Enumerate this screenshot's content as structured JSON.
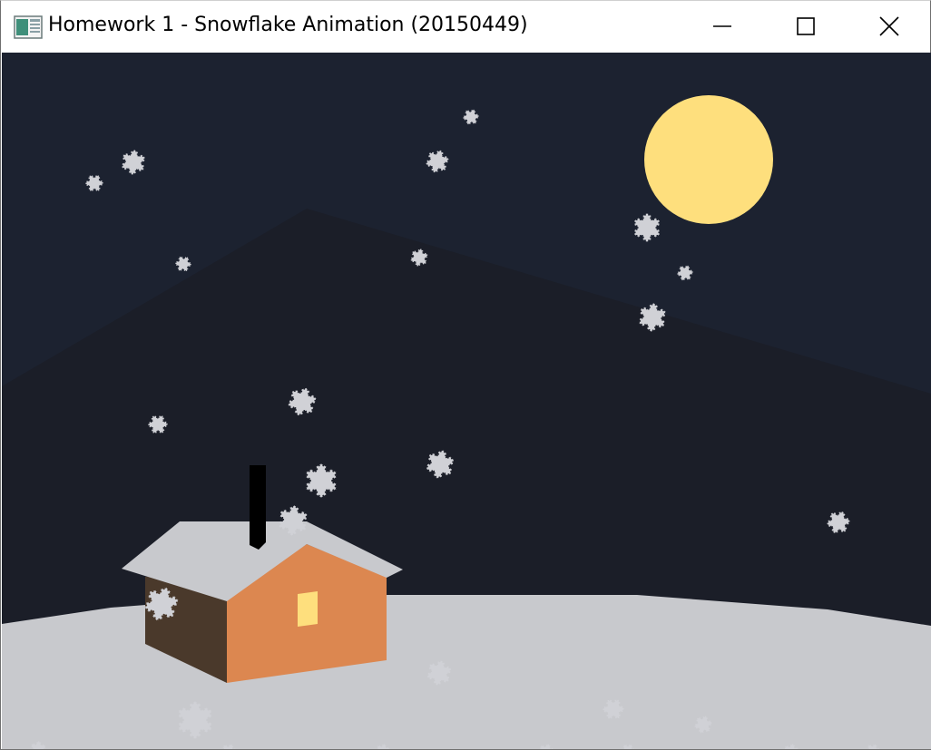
{
  "window": {
    "title": "Homework 1 - Snowflake Animation (20150449)",
    "app_icon": "application-window-icon",
    "controls": {
      "minimize_icon": "minimize-icon",
      "maximize_icon": "maximize-icon",
      "close_icon": "close-icon"
    }
  },
  "scene": {
    "colors": {
      "sky": "#1c2230",
      "mountain": "#1b1e28",
      "moon": "#fedf7d",
      "snow_ground": "#c8c9cd",
      "roof": "#c8c9cd",
      "house_front": "#dc8750",
      "house_side": "#4a392b",
      "window": "#fedf7d",
      "chimney": "#000000",
      "snowflake": "#d0d1d6"
    },
    "snowflake_count": 28
  }
}
